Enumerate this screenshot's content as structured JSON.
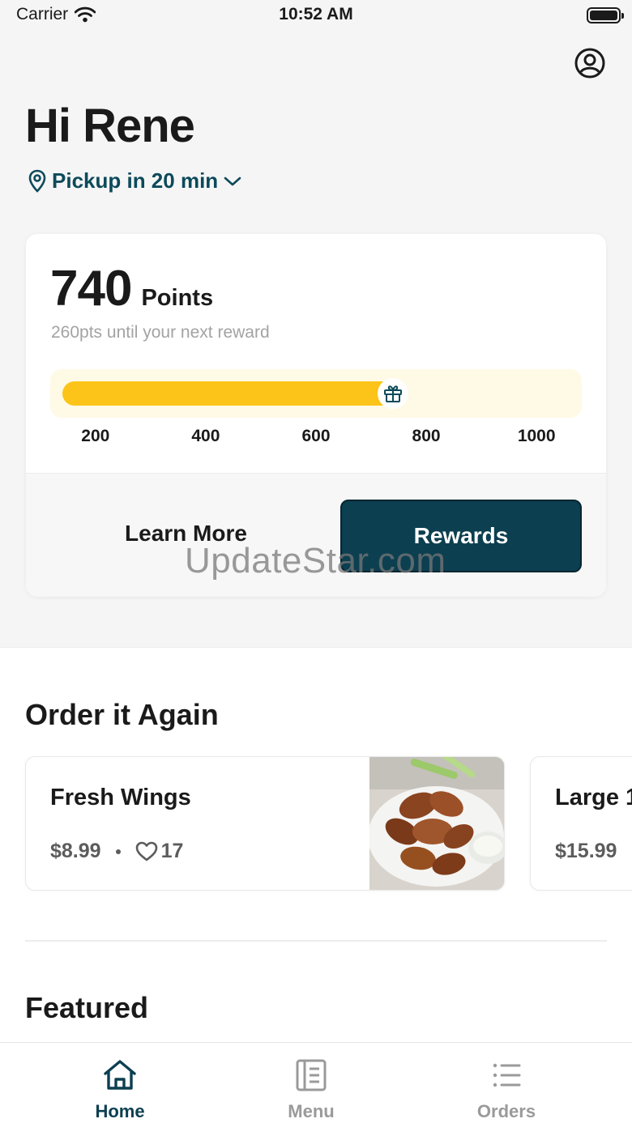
{
  "status_bar": {
    "carrier": "Carrier",
    "time": "10:52 AM"
  },
  "header": {
    "greeting": "Hi Rene",
    "pickup": "Pickup in 20 min"
  },
  "rewards": {
    "points_value": "740",
    "points_label": "Points",
    "subtitle": "260pts until your next reward",
    "progress": {
      "current": 740,
      "min": 140,
      "max": 1060
    },
    "ticks": [
      {
        "label": "200",
        "value": 200
      },
      {
        "label": "400",
        "value": 400
      },
      {
        "label": "600",
        "value": 600
      },
      {
        "label": "800",
        "value": 800
      },
      {
        "label": "1000",
        "value": 1000
      }
    ],
    "learn_more": "Learn More",
    "rewards_button": "Rewards"
  },
  "watermark": "UpdateStar.com",
  "order_again": {
    "title": "Order it Again",
    "items": [
      {
        "name": "Fresh Wings",
        "price": "$8.99",
        "likes": "17"
      },
      {
        "name": "Large 1",
        "price": "$15.99"
      }
    ]
  },
  "featured": {
    "title": "Featured"
  },
  "tab_bar": {
    "home": "Home",
    "menu": "Menu",
    "orders": "Orders"
  },
  "colors": {
    "brand": "#0c3f50",
    "accent": "#fcc419",
    "progress_track": "#fffae6",
    "pickup_text": "#0c4a5a",
    "inactive_tab": "#9a9a9a"
  }
}
